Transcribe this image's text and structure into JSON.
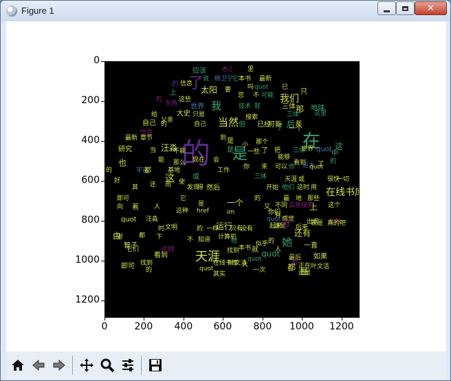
{
  "window": {
    "title": "Figure 1",
    "controls": {
      "minimize": "minimize",
      "maximize": "maximize",
      "close": "✕"
    }
  },
  "plot": {
    "y_ticks": [
      "0",
      "200",
      "400",
      "600",
      "800",
      "1000",
      "1200"
    ],
    "x_ticks": [
      "0",
      "200",
      "400",
      "600",
      "800",
      "1000",
      "1200"
    ]
  },
  "word_cloud": {
    "words": [
      {
        "text": "应该",
        "color": "#3aa373"
      },
      {
        "text": "通过",
        "color": "#7a1f7a"
      },
      {
        "text": "里",
        "color": "#cfe04a"
      },
      {
        "text": "了",
        "color": "#5b2a8e"
      },
      {
        "text": "说",
        "color": "#3aa373"
      },
      {
        "text": "杨卫宁",
        "color": "#4a7ab0"
      },
      {
        "text": "它",
        "color": "#3aa373"
      },
      {
        "text": "本书",
        "color": "#cfe04a"
      },
      {
        "text": "最新",
        "color": "#cfe04a"
      },
      {
        "text": "的",
        "color": "#5b2a8e"
      },
      {
        "text": "信息",
        "color": "#cfe04a"
      },
      {
        "text": "太阳",
        "color": "#cfe04a"
      },
      {
        "text": "要",
        "color": "#cfe04a"
      },
      {
        "text": "吗",
        "color": "#cfe04a"
      },
      {
        "text": "quot",
        "color": "#3aa373"
      },
      {
        "text": "已",
        "color": "#cfe04a"
      },
      {
        "text": "只",
        "color": "#cfe04a"
      },
      {
        "text": "我们",
        "color": "#cfe04a"
      },
      {
        "text": "您",
        "color": "#cfe04a"
      },
      {
        "text": "不",
        "color": "#cfe04a"
      },
      {
        "text": "可能",
        "color": "#3aa373"
      },
      {
        "text": "上",
        "color": "#3aa373"
      },
      {
        "text": "的",
        "color": "#7a1f7a"
      },
      {
        "text": "这些",
        "color": "#cfe04a"
      },
      {
        "text": "东西",
        "color": "#7a1f7a"
      },
      {
        "text": "世界",
        "color": "#4a7ab0"
      },
      {
        "text": "我",
        "color": "#3aa373"
      },
      {
        "text": "技术",
        "color": "#3aa373"
      },
      {
        "text": "就",
        "color": "#3aa373"
      },
      {
        "text": "三体",
        "color": "#cfe04a"
      },
      {
        "text": "地球",
        "color": "#3aa373"
      },
      {
        "text": "那",
        "color": "#cfe04a"
      },
      {
        "text": "后",
        "color": "#3aa373"
      },
      {
        "text": "这里",
        "color": "#3aa373"
      },
      {
        "text": "给",
        "color": "#cfe04a"
      },
      {
        "text": "大史",
        "color": "#cfe04a"
      },
      {
        "text": "只是",
        "color": "#cfe04a"
      },
      {
        "text": "自己",
        "color": "#cfe04a"
      },
      {
        "text": "的",
        "color": "#cfe04a"
      },
      {
        "text": "搜索",
        "color": "#cfe04a"
      },
      {
        "text": "三体",
        "color": "#3aa373"
      },
      {
        "text": "在",
        "color": "#3aa373"
      },
      {
        "text": "父亲",
        "color": "#cfe04a"
      },
      {
        "text": "自己",
        "color": "#cfe04a"
      },
      {
        "text": "当然",
        "color": "#cfe04a"
      },
      {
        "text": "但",
        "color": "#3aa373"
      },
      {
        "text": "已经",
        "color": "#cfe04a"
      },
      {
        "text": "可能",
        "color": "#cfe04a"
      },
      {
        "text": "了",
        "color": "#3aa373"
      },
      {
        "text": "一个",
        "color": "#cfe04a"
      },
      {
        "text": "那",
        "color": "#cfe04a"
      },
      {
        "text": "是",
        "color": "#3aa373"
      },
      {
        "text": "信息",
        "color": "#7a1f7a"
      },
      {
        "text": "的",
        "color": "#5b2a8e"
      },
      {
        "text": "最新",
        "color": "#cfe04a"
      },
      {
        "text": "章节",
        "color": "#cfe04a"
      },
      {
        "text": "到",
        "color": "#cfe04a"
      },
      {
        "text": "是",
        "color": "#cfe04a"
      },
      {
        "text": "这",
        "color": "#3aa373"
      },
      {
        "text": "研究",
        "color": "#cfe04a"
      },
      {
        "text": "汪淼",
        "color": "#cfe04a"
      },
      {
        "text": "不能",
        "color": "#cfe04a"
      },
      {
        "text": "当",
        "color": "#cfe04a"
      },
      {
        "text": "是",
        "color": "#3aa373"
      },
      {
        "text": "小",
        "color": "#cfe04a"
      },
      {
        "text": "那个",
        "color": "#cfe04a"
      },
      {
        "text": "三体",
        "color": "#3aa373"
      },
      {
        "text": "世界",
        "color": "#cfe04a"
      },
      {
        "text": "一些",
        "color": "#cfe04a"
      },
      {
        "text": "了",
        "color": "#cfe04a"
      },
      {
        "text": "quot",
        "color": "#4a7ab0"
      },
      {
        "text": "把",
        "color": "#cfe04a"
      },
      {
        "text": "中",
        "color": "#3aa373"
      },
      {
        "text": "的",
        "color": "#3aa373"
      },
      {
        "text": "也",
        "color": "#cfe04a"
      },
      {
        "text": "能",
        "color": "#cfe04a"
      },
      {
        "text": "那么",
        "color": "#cfe04a"
      },
      {
        "text": "现在",
        "color": "#cfe04a"
      },
      {
        "text": "会",
        "color": "#cfe04a"
      },
      {
        "text": "能够",
        "color": "#cfe04a"
      },
      {
        "text": "看到",
        "color": "#cfe04a"
      },
      {
        "text": "了",
        "color": "#cfe04a"
      },
      {
        "text": "巨大",
        "color": "#4a7ab0"
      },
      {
        "text": "的",
        "color": "#cfe04a"
      },
      {
        "text": "宇宙",
        "color": "#4a7ab0"
      },
      {
        "text": "都",
        "color": "#cfe04a"
      },
      {
        "text": "工作",
        "color": "#cfe04a"
      },
      {
        "text": "你",
        "color": "#cfe04a"
      },
      {
        "text": "来",
        "color": "#cfe04a"
      },
      {
        "text": "可以",
        "color": "#cfe04a"
      },
      {
        "text": "你",
        "color": "#3aa373"
      },
      {
        "text": "quot",
        "color": "#cfe04a"
      },
      {
        "text": "这",
        "color": "#cfe04a"
      },
      {
        "text": "还",
        "color": "#cfe04a"
      },
      {
        "text": "而",
        "color": "#cfe04a"
      },
      {
        "text": "使",
        "color": "#cfe04a"
      },
      {
        "text": "基地",
        "color": "#cfe04a"
      },
      {
        "text": "或",
        "color": "#3aa373"
      },
      {
        "text": "三体",
        "color": "#3aa373"
      },
      {
        "text": "天涯",
        "color": "#cfe04a"
      },
      {
        "text": "或",
        "color": "#cfe04a"
      },
      {
        "text": "很快",
        "color": "#cfe04a"
      },
      {
        "text": "一切",
        "color": "#cfe04a"
      },
      {
        "text": "好",
        "color": "#cfe04a"
      },
      {
        "text": "其",
        "color": "#cfe04a"
      },
      {
        "text": "发现",
        "color": "#cfe04a"
      },
      {
        "text": "得",
        "color": "#cfe04a"
      },
      {
        "text": "然后",
        "color": "#cfe04a"
      },
      {
        "text": "开始",
        "color": "#cfe04a"
      },
      {
        "text": "他们",
        "color": "#3aa373"
      },
      {
        "text": "这时",
        "color": "#cfe04a"
      },
      {
        "text": "用",
        "color": "#cfe04a"
      },
      {
        "text": "在线书库",
        "color": "#cfe04a"
      },
      {
        "text": "即可",
        "color": "#cfe04a"
      },
      {
        "text": "它",
        "color": "#cfe04a"
      },
      {
        "text": "的",
        "color": "#cfe04a"
      },
      {
        "text": "最",
        "color": "#cfe04a"
      },
      {
        "text": "地",
        "color": "#cfe04a"
      },
      {
        "text": "那些",
        "color": "#cfe04a"
      },
      {
        "text": "向",
        "color": "#cfe04a"
      },
      {
        "text": "着",
        "color": "#cfe04a"
      },
      {
        "text": "人",
        "color": "#cfe04a"
      },
      {
        "text": "是",
        "color": "#cfe04a"
      },
      {
        "text": "一个",
        "color": "#cfe04a"
      },
      {
        "text": "又",
        "color": "#cfe04a"
      },
      {
        "text": "不同",
        "color": "#cfe04a"
      },
      {
        "text": "百度",
        "color": "#7a1f7a"
      },
      {
        "text": "搜索",
        "color": "#7a1f7a"
      },
      {
        "text": "上",
        "color": "#cfe04a"
      },
      {
        "text": "这个",
        "color": "#cfe04a"
      },
      {
        "text": "这种",
        "color": "#cfe04a"
      },
      {
        "text": "href",
        "color": "#cfe04a"
      },
      {
        "text": "im",
        "color": "#cfe04a"
      },
      {
        "text": "你们",
        "color": "#cfe04a"
      },
      {
        "text": "有",
        "color": "#cfe04a"
      },
      {
        "text": "quot",
        "color": "#4a7ab0"
      },
      {
        "text": "感觉",
        "color": "#cfe04a"
      },
      {
        "text": "出现",
        "color": "#cfe04a"
      },
      {
        "text": "发射",
        "color": "#7a1f7a"
      },
      {
        "text": "这是",
        "color": "#cfe04a"
      },
      {
        "text": "起来",
        "color": "#cfe04a"
      },
      {
        "text": "后来",
        "color": "#cfe04a"
      },
      {
        "text": "就是",
        "color": "#cfe04a"
      },
      {
        "text": "真的",
        "color": "#cfe04a"
      },
      {
        "text": "吧",
        "color": "#cfe04a"
      },
      {
        "text": "quot",
        "color": "#cfe04a"
      },
      {
        "text": "汪淼",
        "color": "#cfe04a"
      },
      {
        "text": "时",
        "color": "#cfe04a"
      },
      {
        "text": "文明",
        "color": "#cfe04a"
      },
      {
        "text": "的",
        "color": "#cfe04a"
      },
      {
        "text": "一样",
        "color": "#cfe04a"
      },
      {
        "text": "运行",
        "color": "#cfe04a"
      },
      {
        "text": "只有",
        "color": "#cfe04a"
      },
      {
        "text": "没有",
        "color": "#cfe04a"
      },
      {
        "text": "母",
        "color": "#7a1f7a"
      },
      {
        "text": "还有",
        "color": "#cfe04a"
      },
      {
        "text": "它们",
        "color": "#cfe04a"
      },
      {
        "text": "由",
        "color": "#cfe04a"
      },
      {
        "text": "都",
        "color": "#cfe04a"
      },
      {
        "text": "下",
        "color": "#cfe04a"
      },
      {
        "text": "不",
        "color": "#cfe04a"
      },
      {
        "text": "知道",
        "color": "#cfe04a"
      },
      {
        "text": "计算机",
        "color": "#cfe04a"
      },
      {
        "text": "他",
        "color": "#3aa373"
      },
      {
        "text": "找到",
        "color": "#cfe04a"
      },
      {
        "text": "本书",
        "color": "#cfe04a"
      },
      {
        "text": "就",
        "color": "#cfe04a"
      },
      {
        "text": "似乎",
        "color": "#cfe04a"
      },
      {
        "text": "的",
        "color": "#cfe04a"
      },
      {
        "text": "人",
        "color": "#cfe04a"
      },
      {
        "text": "她",
        "color": "#3aa373"
      },
      {
        "text": "一直",
        "color": "#cfe04a"
      },
      {
        "text": "最后",
        "color": "#cfe04a"
      },
      {
        "text": "对",
        "color": "#cfe04a"
      },
      {
        "text": "智子",
        "color": "#cfe04a"
      },
      {
        "text": "看到",
        "color": "#cfe04a"
      },
      {
        "text": "这样",
        "color": "#7a1f7a"
      },
      {
        "text": "天涯",
        "color": "#cfe04a"
      },
      {
        "text": "在线书库",
        "color": "#cfe04a"
      },
      {
        "text": "叶文洁",
        "color": "#cfe04a"
      },
      {
        "text": "大",
        "color": "#cfe04a"
      },
      {
        "text": "quot",
        "color": "#3aa373"
      },
      {
        "text": "quot",
        "color": "#3aa373"
      },
      {
        "text": "如果",
        "color": "#cfe04a"
      },
      {
        "text": "叶文洁",
        "color": "#cfe04a"
      },
      {
        "text": "和",
        "color": "#7a1f7a"
      },
      {
        "text": "一次",
        "color": "#cfe04a"
      },
      {
        "text": "正在",
        "color": "#cfe04a"
      },
      {
        "text": "还是",
        "color": "#cfe04a"
      },
      {
        "text": "都",
        "color": "#cfe04a"
      },
      {
        "text": "是",
        "color": "#cfe04a"
      },
      {
        "text": "即可",
        "color": "#cfe04a"
      },
      {
        "text": "找到",
        "color": "#cfe04a"
      },
      {
        "text": "的",
        "color": "#cfe04a"
      },
      {
        "text": "quot",
        "color": "#cfe04a"
      },
      {
        "text": "其实",
        "color": "#cfe04a"
      }
    ]
  },
  "toolbar": {
    "buttons": [
      "home-icon",
      "back-icon",
      "forward-icon",
      "pan-icon",
      "zoom-icon",
      "configure-icon",
      "save-icon"
    ]
  }
}
